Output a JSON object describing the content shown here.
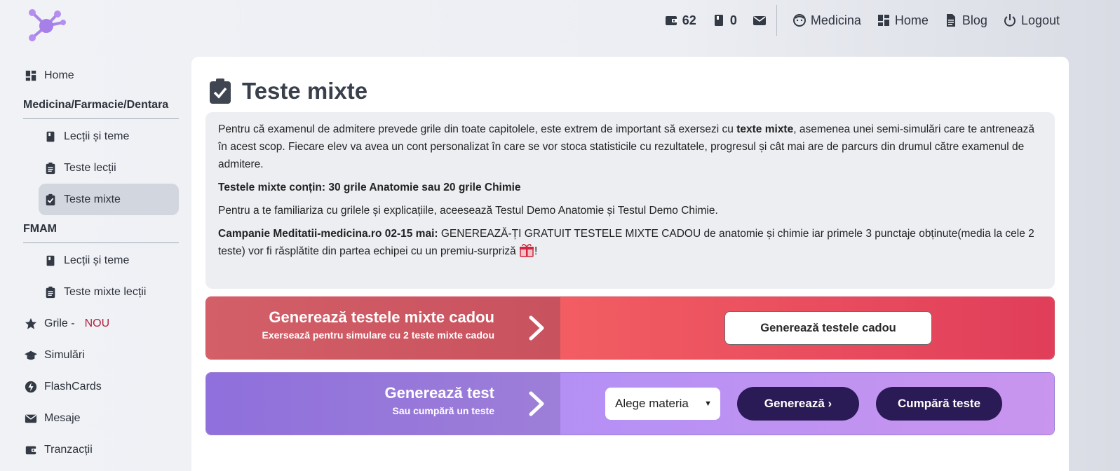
{
  "topbar": {
    "wallet_count": "62",
    "book_count": "0",
    "profile_label": "Medicina",
    "home_label": "Home",
    "blog_label": "Blog",
    "logout_label": "Logout"
  },
  "sidebar": {
    "home": "Home",
    "section1": "Medicina/Farmacie/Dentara",
    "s1_items": [
      "Lecții și teme",
      "Teste lecții",
      "Teste mixte"
    ],
    "section2": "FMAM",
    "s2_items": [
      "Lecții și teme",
      "Teste mixte lecții"
    ],
    "grile": "Grile -",
    "grile_badge": "NOU",
    "simulari": "Simulări",
    "flashcards": "FlashCards",
    "mesaje": "Mesaje",
    "tranzactii": "Tranzacții"
  },
  "main": {
    "title": "Teste mixte",
    "p1_a": "Pentru că examenul de admitere prevede grile din toate capitolele, este extrem de important să exersezi cu ",
    "p1_bold": "texte mixte",
    "p1_b": ", asemenea unei semi-simulări care te antrenează în acest scop. Fiecare elev va avea un cont personalizat în care se vor stoca statisticile cu rezultatele, progresul și cât mai are de parcurs din drumul către examenul de admitere.",
    "p2": "Testele mixte conțin: 30 grile Anatomie sau 20 grile Chimie",
    "p3": "Pentru a te familiariza cu grilele și explicațiile, aceesează Testul Demo Anatomie și Testul Demo Chimie.",
    "p4_bold": "Campanie Meditatii-medicina.ro 02-15 mai:",
    "p4_text": " GENEREAZĂ-ȚI GRATUIT TESTELE MIXTE CADOU de anatomie și chimie iar primele 3 punctaje obținute(media la cele 2 teste) vor fi răsplătite din partea echipei cu un premiu-surpriză ",
    "p4_end": "!"
  },
  "banner_gift": {
    "title": "Generează testele mixte cadou",
    "subtitle": "Exersează pentru simulare cu 2 teste mixte cadou",
    "button": "Generează testele cadou"
  },
  "banner_test": {
    "title": "Generează test",
    "subtitle": "Sau cumpără un teste",
    "select_value": "Alege materia",
    "generate": "Generează ›",
    "buy": "Cumpără teste"
  },
  "colors": {
    "red_banner": "#e04d5d",
    "purple_banner": "#a383e0",
    "dark_button": "#2a1a55",
    "badge_red": "#b0223d"
  }
}
